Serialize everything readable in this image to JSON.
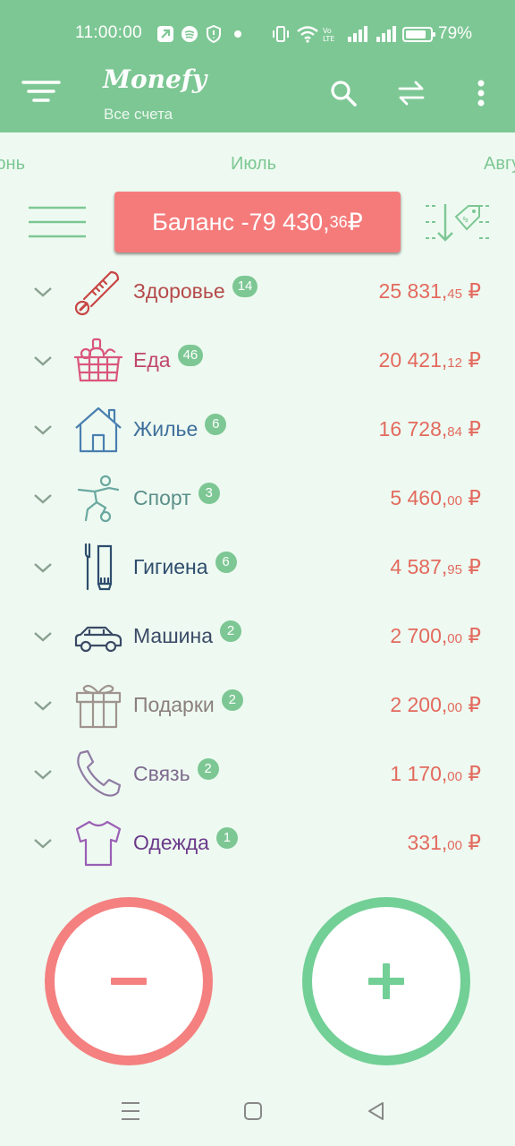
{
  "status_bar": {
    "time": "11:00:00",
    "battery_percent": "79%",
    "icons": [
      "share-arrow-icon",
      "spotify-icon",
      "shield-icon",
      "dot-icon",
      "vibrate-icon",
      "wifi-icon",
      "volte-icon",
      "signal-icon",
      "signal-icon",
      "battery-icon"
    ]
  },
  "app": {
    "title": "Monefy",
    "subtitle": "Все счета"
  },
  "months": {
    "prev": "Июнь",
    "current": "Июль",
    "next": "Август"
  },
  "balance": {
    "label": "Баланс",
    "integer": "-79 430,",
    "cents": "36",
    "currency": " ₽"
  },
  "categories": [
    {
      "name": "Здоровье",
      "count": "14",
      "amount": "25 831,",
      "cents": "45",
      "currency": " ₽",
      "color": "#b54a4a",
      "icon": "thermometer-icon"
    },
    {
      "name": "Еда",
      "count": "46",
      "amount": "20 421,",
      "cents": "12",
      "currency": " ₽",
      "color": "#c0476a",
      "icon": "food-basket-icon"
    },
    {
      "name": "Жилье",
      "count": "6",
      "amount": "16 728,",
      "cents": "84",
      "currency": " ₽",
      "color": "#3f6f9c",
      "icon": "house-icon"
    },
    {
      "name": "Спорт",
      "count": "3",
      "amount": "5 460,",
      "cents": "00",
      "currency": " ₽",
      "color": "#5a8f8a",
      "icon": "football-player-icon"
    },
    {
      "name": "Гигиена",
      "count": "6",
      "amount": "4 587,",
      "cents": "95",
      "currency": " ₽",
      "color": "#2e4d6d",
      "icon": "toothbrush-icon"
    },
    {
      "name": "Машина",
      "count": "2",
      "amount": "2 700,",
      "cents": "00",
      "currency": " ₽",
      "color": "#3a4a66",
      "icon": "car-icon"
    },
    {
      "name": "Подарки",
      "count": "2",
      "amount": "2 200,",
      "cents": "00",
      "currency": " ₽",
      "color": "#8b7f7c",
      "icon": "gift-icon"
    },
    {
      "name": "Связь",
      "count": "2",
      "amount": "1 170,",
      "cents": "00",
      "currency": " ₽",
      "color": "#7e6b8f",
      "icon": "phone-icon"
    },
    {
      "name": "Одежда",
      "count": "1",
      "amount": "331,",
      "cents": "00",
      "currency": " ₽",
      "color": "#6b3a8a",
      "icon": "tshirt-icon"
    }
  ],
  "colors": {
    "header": "#7dc794",
    "background": "#eefaf1",
    "balance_bg": "#f57b7b",
    "expense_button": "#f48080",
    "income_button": "#72cf96",
    "amount": "#e36a5e",
    "badge": "#7dc794"
  },
  "nav": {
    "icons": [
      "menu-lines-icon",
      "home-square-icon",
      "back-triangle-icon"
    ]
  }
}
